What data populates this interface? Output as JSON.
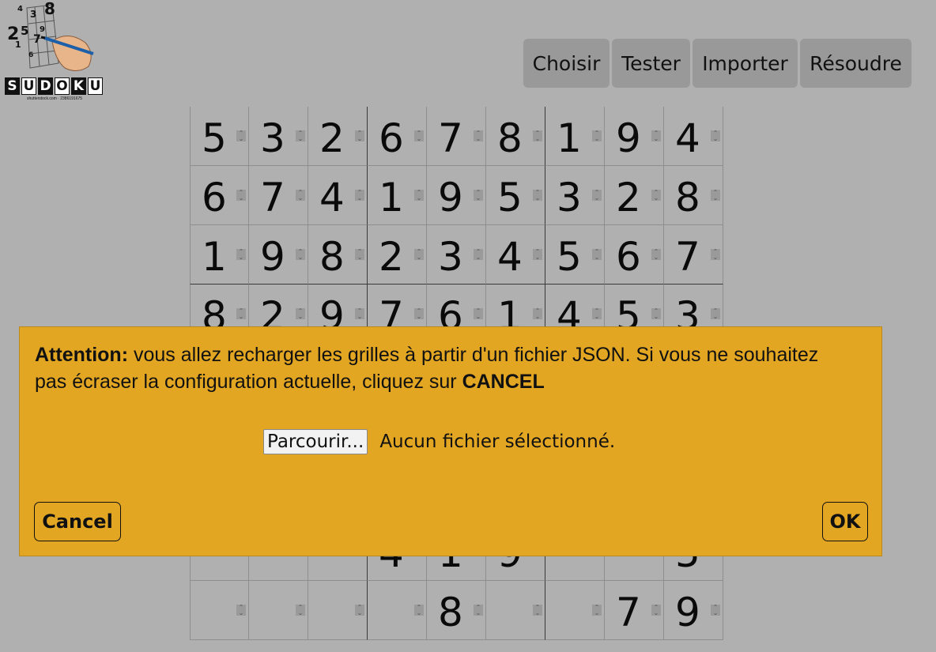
{
  "logo": {
    "word_letters": [
      "S",
      "U",
      "D",
      "O",
      "K",
      "U"
    ],
    "credit": "shutterstock.com · 2386191675"
  },
  "toolbar": [
    {
      "name": "choisir-button",
      "label": "Choisir"
    },
    {
      "name": "tester-button",
      "label": "Tester"
    },
    {
      "name": "importer-button",
      "label": "Importer"
    },
    {
      "name": "resoudre-button",
      "label": "Résoudre"
    }
  ],
  "grid": [
    [
      "5",
      "3",
      "2",
      "6",
      "7",
      "8",
      "1",
      "9",
      "4"
    ],
    [
      "6",
      "7",
      "4",
      "1",
      "9",
      "5",
      "3",
      "2",
      "8"
    ],
    [
      "1",
      "9",
      "8",
      "2",
      "3",
      "4",
      "5",
      "6",
      "7"
    ],
    [
      "8",
      "2",
      "9",
      "7",
      "6",
      "1",
      "4",
      "5",
      "3"
    ],
    [
      "",
      "",
      "",
      "",
      "",
      "",
      "",
      "",
      ""
    ],
    [
      "",
      "",
      "",
      "",
      "",
      "",
      "",
      "",
      ""
    ],
    [
      "",
      "",
      "",
      "",
      "",
      "",
      "",
      "",
      ""
    ],
    [
      "",
      "",
      "",
      "4",
      "1",
      "9",
      "",
      "",
      "5"
    ],
    [
      "",
      "",
      "",
      "",
      "8",
      "",
      "",
      "7",
      "9"
    ]
  ],
  "dialog": {
    "prefix_bold": "Attention:",
    "message": " vous allez recharger les grilles à partir d'un fichier JSON. Si vous ne souhaitez pas écraser la configuration actuelle, cliquez sur ",
    "suffix_bold": "CANCEL",
    "browse_label": "Parcourir...",
    "no_file_text": "Aucun fichier sélectionné.",
    "cancel_label": "Cancel",
    "ok_label": "OK",
    "background_color": "#e2a623"
  }
}
